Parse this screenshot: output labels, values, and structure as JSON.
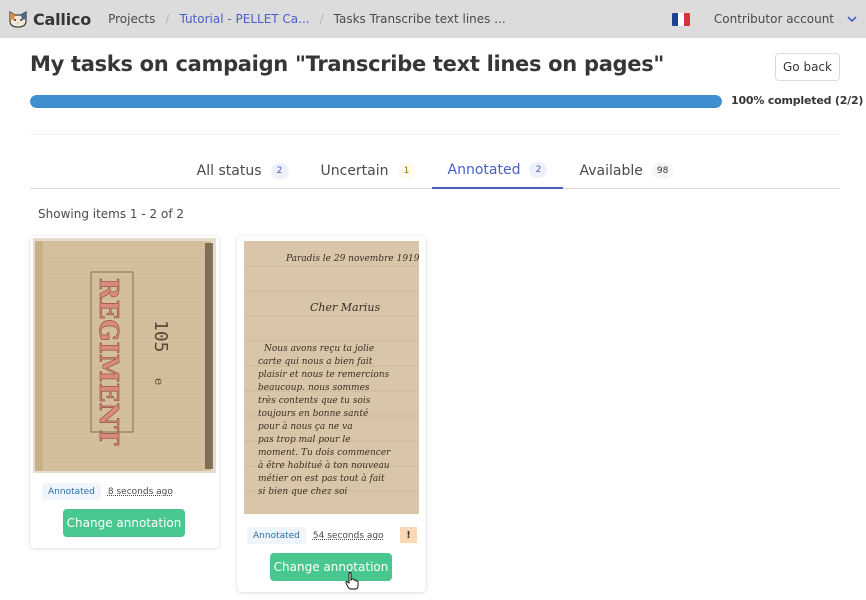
{
  "navbar": {
    "brand": "Callico",
    "breadcrumbs": [
      {
        "label": "Projects",
        "link": false
      },
      {
        "label": "Tutorial - PELLET Ca...",
        "link": true
      },
      {
        "label": "Tasks Transcribe text lines ...",
        "link": false
      }
    ],
    "language_flag": "fr-flag-icon",
    "account_label": "Contributor account"
  },
  "header": {
    "title": "My tasks on campaign \"Transcribe text lines on pages\"",
    "go_back_label": "Go back"
  },
  "progress": {
    "percent": 100,
    "label": "100% completed (2/2)",
    "color": "#3e8ed0"
  },
  "tabs": [
    {
      "label": "All status",
      "count": "2",
      "active": false
    },
    {
      "label": "Uncertain",
      "count": "1",
      "active": false
    },
    {
      "label": "Annotated",
      "count": "2",
      "active": true
    },
    {
      "label": "Available",
      "count": "98",
      "active": false
    }
  ],
  "listing": {
    "showing_text": "Showing items 1 - 2 of 2"
  },
  "items": [
    {
      "image_alt": "Notebook cover: REGIMENT 105e",
      "status": "Annotated",
      "time": "8 seconds ago",
      "uncertain": false,
      "action_label": "Change annotation"
    },
    {
      "image_alt": "Handwritten letter: Paradis le 29 novembre 1919, Cher Marius",
      "status": "Annotated",
      "time": "54 seconds ago",
      "uncertain": true,
      "uncertain_icon": "!",
      "action_label": "Change annotation"
    }
  ],
  "colors": {
    "primary": "#485fc7",
    "success": "#48c78e",
    "navbar_bg": "#dcdcdc"
  }
}
